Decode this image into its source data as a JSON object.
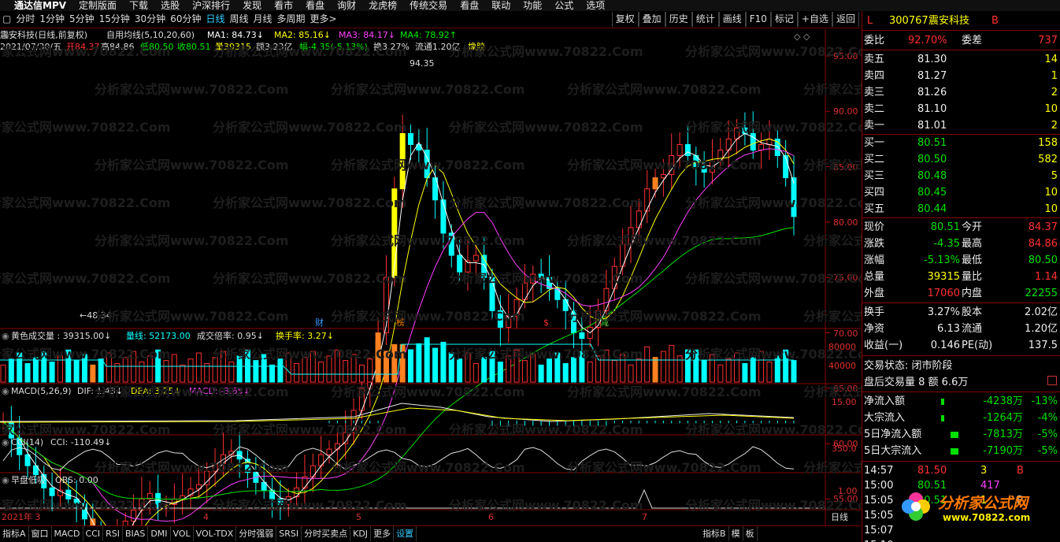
{
  "titlebar": {
    "app": "通达信MPV",
    "menus": [
      "定制版面",
      "下载",
      "选股",
      "沪深排行",
      "发现",
      "看市",
      "看盘",
      "询财",
      "龙虎榜",
      "传统交易",
      "看盘",
      "联动",
      "功能",
      "公式",
      "选项"
    ]
  },
  "toolbar": {
    "periods": [
      "分时",
      "1分钟",
      "5分钟",
      "15分钟",
      "30分钟",
      "60分钟",
      "日线",
      "周线",
      "月线",
      "多周期",
      "更多>"
    ],
    "active": "日线",
    "right_buttons": [
      "复权",
      "叠加",
      "历史",
      "统计",
      "画线",
      "F10",
      "标记",
      "+自选",
      "返回"
    ]
  },
  "main_chart": {
    "title": "震安科技(日线,前复权)",
    "indicator": "自用均线(5,10,20,60)",
    "ma1": "MA1: 84.73↓",
    "ma2": "MA2: 85.16↓",
    "ma3": "MA3: 84.17↓",
    "ma4": "MA4: 78.92↑",
    "date": "2021/07/30/五",
    "open": "开84.37",
    "high": "高84.86",
    "low": "低80.50",
    "close": "收80.51",
    "volume": "量39315",
    "amount": "额3.23亿",
    "change": "幅-4.35(-5.13%)",
    "turnover": "换3.27%",
    "float": "流通1.20亿",
    "sector": "橡胶",
    "high_mark": "94.35",
    "low_mark": "←48.34",
    "events": [
      "财",
      "榜",
      "$",
      "减"
    ],
    "yaxis": [
      "95.00",
      "90.00",
      "85.00",
      "80.00",
      "75.00",
      "70.00",
      "65.00",
      "60.00",
      "55.00",
      "50.00"
    ]
  },
  "volume_panel": {
    "title": "黄色成交量 : 39315.00↓",
    "vline": "量线: 52173.00",
    "ratio": "成交倍率: 0.95↓",
    "turn": "换手率: 3.27↓",
    "yaxis": [
      "80000",
      "40000"
    ]
  },
  "macd_panel": {
    "title": "MACD(5,26,9)",
    "dif": "DIF: 1.43↓",
    "dea": "DEA: 3.25↓",
    "macd": "MACD: -3.65↓",
    "yaxis": [
      "15.00"
    ]
  },
  "cci_panel": {
    "title": "CCI(14)",
    "cci": "CCI: -110.49↓",
    "yaxis": [
      "350.0"
    ]
  },
  "obs_panel": {
    "title": "早盘低吸",
    "obs": "OBS: 0.00",
    "yaxis": [
      "1.00"
    ]
  },
  "time_axis": {
    "labels": [
      "2021年 3",
      "4",
      "5",
      "6",
      "7"
    ],
    "right_label": "日线"
  },
  "bottombar": [
    "指标A",
    "窗口",
    "MACD",
    "CCI",
    "RSI",
    "BIAS",
    "DMI",
    "VOL",
    "VOL-TDX",
    "分时强弱",
    "SRSI",
    "分时买卖点",
    "KDJ",
    "更多",
    "设置",
    "指标B",
    "模",
    "板"
  ],
  "quote": {
    "flag": "L",
    "code": "300767",
    "name": "震安科技",
    "badge": "B",
    "weibi": {
      "label": "委比",
      "value": "92.70%",
      "label2": "委差",
      "value2": "737"
    },
    "sells": [
      {
        "label": "卖五",
        "price": "81.30",
        "vol": "14"
      },
      {
        "label": "卖四",
        "price": "81.27",
        "vol": "1"
      },
      {
        "label": "卖三",
        "price": "81.26",
        "vol": "2"
      },
      {
        "label": "卖二",
        "price": "81.10",
        "vol": "10"
      },
      {
        "label": "卖一",
        "price": "81.01",
        "vol": "2"
      }
    ],
    "buys": [
      {
        "label": "买一",
        "price": "80.51",
        "vol": "158"
      },
      {
        "label": "买二",
        "price": "80.50",
        "vol": "582"
      },
      {
        "label": "买三",
        "price": "80.48",
        "vol": "5"
      },
      {
        "label": "买四",
        "price": "80.45",
        "vol": "10"
      },
      {
        "label": "买五",
        "price": "80.44",
        "vol": "10"
      }
    ],
    "stats": [
      {
        "l1": "现价",
        "v1": "80.51",
        "l2": "今开",
        "v2": "84.37"
      },
      {
        "l1": "涨跌",
        "v1": "-4.35",
        "l2": "最高",
        "v2": "84.86"
      },
      {
        "l1": "涨幅",
        "v1": "-5.13%",
        "l2": "最低",
        "v2": "80.50"
      },
      {
        "l1": "总量",
        "v1": "39315",
        "l2": "量比",
        "v2": "1.14"
      },
      {
        "l1": "外盘",
        "v1": "17060",
        "l2": "内盘",
        "v2": "22255"
      }
    ],
    "stats2": [
      {
        "l1": "换手",
        "v1": "3.27%",
        "l2": "股本",
        "v2": "2.02亿"
      },
      {
        "l1": "净资",
        "v1": "6.13",
        "l2": "流通",
        "v2": "1.20亿"
      },
      {
        "l1": "收益(一)",
        "v1": "0.146",
        "l2": "PE(动)",
        "v2": "137.5"
      }
    ],
    "status": "交易状态: 闭市阶段",
    "afterhours": "盘后交易量 8 额 6.6万",
    "flows": [
      {
        "label": "净流入额",
        "value": "-4238万",
        "pct": "-13%"
      },
      {
        "label": "大宗流入",
        "value": "-1264万",
        "pct": "-4%"
      },
      {
        "label": "5日净流入额",
        "value": "-7813万",
        "pct": "-5%"
      },
      {
        "label": "5日大宗流入",
        "value": "-7190万",
        "pct": "-5%"
      }
    ],
    "ticks": [
      {
        "time": "14:57",
        "price": "81.50",
        "vol": "3",
        "flag": "B"
      },
      {
        "time": "15:00",
        "price": "80.51",
        "vol": "417",
        "flag": ""
      },
      {
        "time": "15:05",
        "price": "80.51",
        "vol": "1",
        "flag": "P"
      },
      {
        "time": "15:05",
        "price": "",
        "vol": "",
        "flag": ""
      },
      {
        "time": "15:07",
        "price": "",
        "vol": "",
        "flag": ""
      },
      {
        "time": "15:10",
        "price": "",
        "vol": "",
        "flag": ""
      }
    ]
  },
  "watermark": "分析家公式网www.70822.Com",
  "logo": {
    "text": "分析家公式网",
    "url": "www.70822.com"
  },
  "colors": {
    "up": "#ff3030",
    "down": "#00ffff",
    "ma1": "#ffffff",
    "ma2": "#ffff00",
    "ma3": "#ff40ff",
    "ma4": "#00e000",
    "volbar_orange": "#ff8020"
  }
}
